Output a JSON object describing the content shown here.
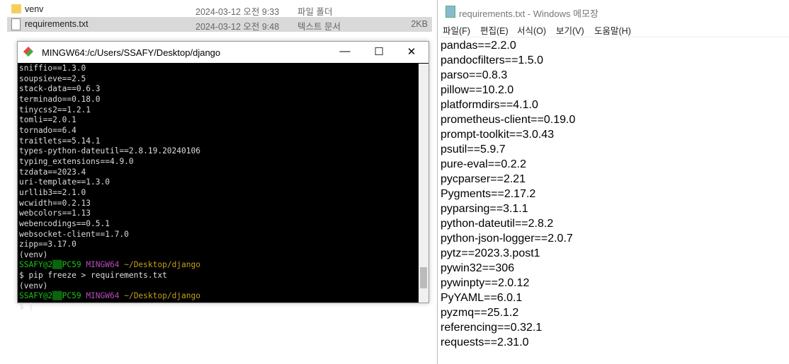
{
  "explorer": {
    "rows": [
      {
        "name": "venv",
        "date": "2024-03-12 오전 9:33",
        "type": "파일 폴더",
        "size": "",
        "icon": "folder-icon"
      },
      {
        "name": "requirements.txt",
        "date": "2024-03-12 오전 9:48",
        "type": "텍스트 문서",
        "size": "2KB",
        "icon": "text-file-icon"
      }
    ]
  },
  "terminal": {
    "title": "MINGW64:/c/Users/SSAFY/Desktop/django",
    "lines": [
      "sniffio==1.3.0",
      "soupsieve==2.5",
      "stack-data==0.6.3",
      "terminado==0.18.0",
      "tinycss2==1.2.1",
      "tomli==2.0.1",
      "tornado==6.4",
      "traitlets==5.14.1",
      "types-python-dateutil==2.8.19.20240106",
      "typing_extensions==4.9.0",
      "tzdata==2023.4",
      "uri-template==1.3.0",
      "urllib3==2.1.0",
      "wcwidth==0.2.13",
      "webcolors==1.13",
      "webencodings==0.5.1",
      "websocket-client==1.7.0",
      "zipp==3.17.0",
      "(venv)"
    ],
    "prompt_user": "SSAFY@2▒▒PC59",
    "prompt_sys": "MINGW64",
    "prompt_path": "~/Desktop/django",
    "command": "$ pip freeze > requirements.txt",
    "venv": "(venv)",
    "cursor_line": "$ |"
  },
  "notepad": {
    "title": "requirements.txt - Windows 메모장",
    "menu": [
      "파일(F)",
      "편집(E)",
      "서식(O)",
      "보기(V)",
      "도움말(H)"
    ],
    "lines": [
      "pandas==2.2.0",
      "pandocfilters==1.5.0",
      "parso==0.8.3",
      "pillow==10.2.0",
      "platformdirs==4.1.0",
      "prometheus-client==0.19.0",
      "prompt-toolkit==3.0.43",
      "psutil==5.9.7",
      "pure-eval==0.2.2",
      "pycparser==2.21",
      "Pygments==2.17.2",
      "pyparsing==3.1.1",
      "python-dateutil==2.8.2",
      "python-json-logger==2.0.7",
      "pytz==2023.3.post1",
      "pywin32==306",
      "pywinpty==2.0.12",
      "PyYAML==6.0.1",
      "pyzmq==25.1.2",
      "referencing==0.32.1",
      "requests==2.31.0"
    ]
  }
}
